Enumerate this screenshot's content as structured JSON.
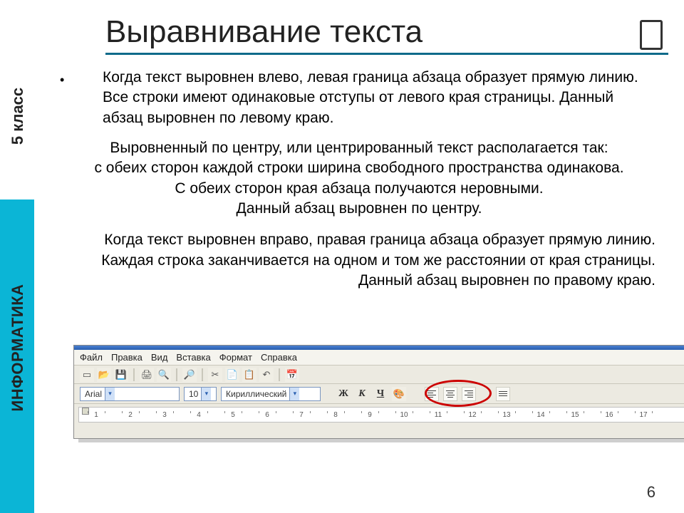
{
  "sidebar": {
    "grade": "5 класс",
    "subject": "ИНФОРМАТИКА"
  },
  "title": "Выравнивание текста",
  "paragraphs": {
    "left": "Когда текст выровнен влево, левая граница абзаца образует прямую линию. Все строки имеют одинаковые отступы от левого края страницы. Данный абзац выровнен по левому краю.",
    "center_l1": "Выровненный по центру, или центрированный текст располагается так:",
    "center_l2": "с обеих сторон каждой строки ширина свободного пространства одинакова.",
    "center_l3": "С обеих сторон края абзаца получаются  неровными.",
    "center_l4": "Данный абзац выровнен по центру.",
    "right": "Когда текст выровнен вправо, правая граница абзаца образует прямую линию. Каждая строка заканчивается на одном и том же расстоянии от края страницы. Данный абзац выровнен по правому краю."
  },
  "toolbar": {
    "menu": {
      "file": "Файл",
      "edit": "Правка",
      "view": "Вид",
      "insert": "Вставка",
      "format": "Формат",
      "help": "Справка"
    },
    "font_name": "Arial",
    "font_size": "10",
    "charset": "Кириллический",
    "bold": "Ж",
    "italic": "К",
    "underline": "Ч",
    "ruler_labels": [
      "1",
      "2",
      "3",
      "4",
      "5",
      "6",
      "7",
      "8",
      "9",
      "10",
      "11",
      "12",
      "13",
      "14",
      "15",
      "16",
      "17"
    ]
  },
  "page_number": "6"
}
